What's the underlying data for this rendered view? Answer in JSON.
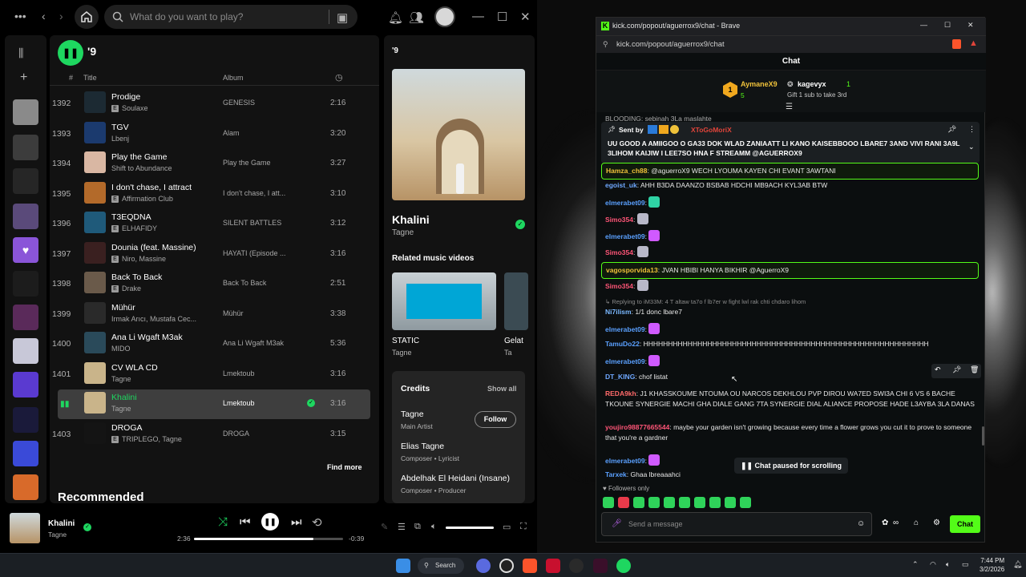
{
  "spotify": {
    "search_placeholder": "What do you want to play?",
    "playlist_title": "'9",
    "columns": {
      "num": "#",
      "title": "Title",
      "album": "Album"
    },
    "tracks": [
      {
        "num": "1392",
        "title": "Prodige",
        "artist": "Soulaxe",
        "explicit": true,
        "album": "GENESIS",
        "duration": "2:16",
        "art": "#1c2a33"
      },
      {
        "num": "1393",
        "title": "TGV",
        "artist": "Lbenj",
        "explicit": false,
        "album": "Alam",
        "duration": "3:20",
        "art": "#1b3a6e"
      },
      {
        "num": "1394",
        "title": "Play the Game",
        "artist": "Shift to Abundance",
        "explicit": false,
        "album": "Play the Game",
        "duration": "3:27",
        "art": "#d9b7a3"
      },
      {
        "num": "1395",
        "title": "I don't chase, I attract",
        "artist": "Affirmation Club",
        "explicit": true,
        "album": "I don't chase, I att...",
        "duration": "3:10",
        "art": "#b36a2a"
      },
      {
        "num": "1396",
        "title": "T3EQDNA",
        "artist": "ELHAFIDY",
        "explicit": true,
        "album": "SILENT BATTLES",
        "duration": "3:12",
        "art": "#1f5a7a"
      },
      {
        "num": "1397",
        "title": "Dounia (feat. Massine)",
        "artist": "Niro, Massine",
        "explicit": true,
        "album": "HAYATI (Episode ...",
        "duration": "3:16",
        "art": "#3a2020"
      },
      {
        "num": "1398",
        "title": "Back To Back",
        "artist": "Drake",
        "explicit": true,
        "album": "Back To Back",
        "duration": "2:51",
        "art": "#6a5a4a"
      },
      {
        "num": "1399",
        "title": "Mühür",
        "artist": "Irmak Arıcı, Mustafa Cec...",
        "explicit": false,
        "album": "Mühür",
        "duration": "3:38",
        "art": "#2a2a2a"
      },
      {
        "num": "1400",
        "title": "Ana Li Wgaft M3ak",
        "artist": "MIDO",
        "explicit": false,
        "album": "Ana Li Wgaft M3ak",
        "duration": "5:36",
        "art": "#2a4a5a"
      },
      {
        "num": "1401",
        "title": "CV WLA CD",
        "artist": "Tagne",
        "explicit": false,
        "album": "Lmektoub",
        "duration": "3:16",
        "art": "#c9b48a"
      },
      {
        "num": "",
        "title": "Khalini",
        "artist": "Tagne",
        "explicit": false,
        "album": "Lmektoub",
        "duration": "3:16",
        "art": "#c9b48a",
        "selected": true
      },
      {
        "num": "1403",
        "title": "DROGA",
        "artist": "TRIPLEGO, Tagne",
        "explicit": true,
        "album": "DROGA",
        "duration": "3:15",
        "art": "#141414"
      }
    ],
    "find_more": "Find more",
    "recommended": "Recommended",
    "now_playing": {
      "label": "'9",
      "title": "Khalini",
      "artist": "Tagne",
      "related_label": "Related music videos",
      "videos": [
        {
          "title": "STATIC",
          "artist": "Tagne"
        },
        {
          "title": "Gelat",
          "artist": "Ta"
        }
      ],
      "credits_label": "Credits",
      "show_all": "Show all",
      "follow": "Follow",
      "credits": [
        {
          "name": "Tagne",
          "role": "Main Artist"
        },
        {
          "name": "Elias Tagne",
          "role": "Composer • Lyricist"
        },
        {
          "name": "Abdelhak El Heidani (Insane)",
          "role": "Composer • Producer"
        }
      ]
    },
    "player": {
      "title": "Khalini",
      "artist": "Tagne",
      "elapsed": "2:36",
      "remaining": "-0:39",
      "progress_fraction": 0.8,
      "volume_fraction": 1.0
    }
  },
  "brave": {
    "window_title": "kick.com/popout/aguerrox9/chat - Brave",
    "url": "kick.com/popout/aguerrox9/chat",
    "chat_header": "Chat",
    "leaderboard": {
      "first_name": "AymaneX9",
      "first_rank": "1",
      "first_count": "5",
      "second_name": "kagevyx",
      "second_count": "1",
      "second_note": "Gift 1 sub to take 3rd"
    },
    "partial_top": "BLOODING: sebinah 3La maslahte",
    "pinned": {
      "sent_by": "Sent by",
      "sender": "XToGoMoriX",
      "text": "UU GOOD A AMIIGOO O GA33 DOK WLAD ZANIAATT LI KANO KAISEBBOOO LBARE7 3AND VIVI RANI 3A9L 3LIHOM KAIJIW I LEE7SO HNA F STREAMM @AGUERROX9"
    },
    "messages": [
      {
        "user": "Hamza_ch88",
        "color": "#f0c23a",
        "text": "@aguerroX9 WECH LYOUMA KAYEN CHI EVANT 3AWTANI",
        "highlight": true
      },
      {
        "user": "egoist_uk",
        "color": "#6fa8ff",
        "text": "AHH B3DA DAANZO BSBAB HDCHI MB9ACH KYL3AB BTW"
      },
      {
        "user": "elmerabet09",
        "color": "#5aa0ff",
        "text": "",
        "emote": "#2fd3a5"
      },
      {
        "user": "Simo354",
        "color": "#ff5577",
        "text": "",
        "emote": "#b8b8c8"
      },
      {
        "user": "elmerabet09",
        "color": "#5aa0ff",
        "text": "",
        "emote": "#d05aff"
      },
      {
        "user": "Simo354",
        "color": "#ff5577",
        "text": "",
        "emote": "#b8b8c8"
      },
      {
        "user": "vagosporvida13",
        "color": "#f0c23a",
        "text": "JVAN HBIBI HANYA BIKHIR @AguerroX9",
        "highlight": true
      },
      {
        "user": "Simo354",
        "color": "#ff5577",
        "text": "",
        "emote": "#b8b8c8"
      },
      {
        "reply": "Replying to iM33M: 4 T altaw ta7o f lb7er w fight lwl rak chti chdaro lihom"
      },
      {
        "user": "Ni7ilism",
        "color": "#7ab8ff",
        "text": "1/1 donc lbare7"
      },
      {
        "user": "elmerabet09",
        "color": "#5aa0ff",
        "text": "",
        "emote": "#d05aff"
      },
      {
        "user": "TamuDo22",
        "color": "#5aa0ff",
        "text": "HHHHHHHHHHHHHHHHHHHHHHHHHHHHHHHHHHHHHHHHHHHHHHHHHHHHHHHHHH"
      },
      {
        "user": "elmerabet09",
        "color": "#5aa0ff",
        "text": "",
        "emote": "#d05aff"
      },
      {
        "user": "DT_KING",
        "color": "#6fa8ff",
        "text": "chof listat"
      },
      {
        "user": "REDA9kh",
        "color": "#ff6a6a",
        "text": "J1 KHASSKOUME NTOUMA OU NARCOS DEKHLOU PVP DIROU WA7ED SWI3A CHI 6 VS 6 BACHE TKOUNE SYNERGIE MACHI GHA DIALE GANG 7TA SYNERGIE DIAL ALIANCE PROPOSE HADE L3AYBA 3LA DANAS"
      },
      {
        "user": "youjiro98877665544",
        "color": "#ff5577",
        "text": "maybe your garden isn't growing because every time a flower grows you cut it to prove to someone that you're a gardner"
      },
      {
        "user": "elmerabet09",
        "color": "#5aa0ff",
        "text": "",
        "emote": "#d05aff"
      },
      {
        "user": "Tarxek",
        "color": "#5aa0ff",
        "text": "Ghaa lbreaaahci"
      }
    ],
    "paused": "Chat paused for scrolling",
    "followers_only": "Followers only",
    "input_placeholder": "Send a message",
    "chat_button": "Chat"
  },
  "taskbar": {
    "search": "Search",
    "time": "7:44 PM",
    "date": "3/2/2026"
  }
}
